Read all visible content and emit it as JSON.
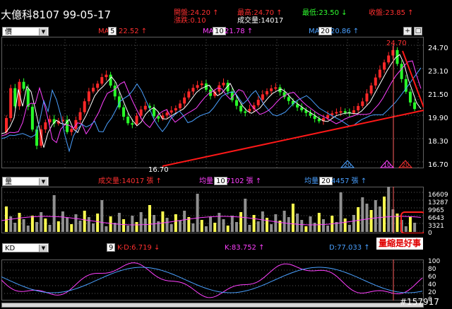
{
  "header": {
    "title": "大億科8107 99-05-17",
    "open_label": "開盤:24.20 ↑",
    "change_label": "漲跌:0.10",
    "high_label": "最高:24.70 ↑",
    "volume_label": "成交量:14017",
    "low_label": "最低:23.50 ↓",
    "close_label": "收盤:23.85 ↑"
  },
  "price_panel": {
    "selector": "價",
    "ma1_label": "MA",
    "ma1_period": "5",
    "ma1_value": "22.52 ↑",
    "ma2_label": "MA",
    "ma2_period": "10",
    "ma2_value": "21.78 ↑",
    "ma3_label": "MA",
    "ma3_period": "20",
    "ma3_value": "20.86 ↑",
    "btn_plus": "+",
    "btn_box": "□",
    "high_marker": "24.70",
    "low_marker": "16.70",
    "axis": [
      "24.70",
      "23.10",
      "21.50",
      "19.90",
      "18.30",
      "16.70"
    ],
    "signal_labels": [
      "20",
      "10",
      "20"
    ]
  },
  "volume_panel": {
    "selector": "量",
    "vol_label": "成交量:14017 張 ↑",
    "avg_label": "均量",
    "avg_period": "10",
    "avg_value": "7102 張 ↑",
    "avg2_label": "均量",
    "avg2_period": "20",
    "avg2_value": "4457 張 ↑",
    "axis": [
      "16609",
      "13287",
      "9965",
      "6643",
      "3321",
      "0"
    ],
    "annotation": "量縮是好事"
  },
  "kd_panel": {
    "selector": "KD",
    "period": "9",
    "kd_label": "K-D:6.719 ↓",
    "k_label": "K:83.752 ↑",
    "d_label": "D:77.033 ↑",
    "axis": [
      "100",
      "80",
      "60",
      "40",
      "20",
      "0"
    ]
  },
  "watermark": "#157917",
  "colors": {
    "up": "#ff2828",
    "down": "#28ff28",
    "ma5": "#ffffff",
    "ma10": "#ff40ff",
    "ma20": "#4aa0ff",
    "trend": "#ff1818",
    "vol_up": "#ffff50",
    "vol_down": "#909090"
  }
}
